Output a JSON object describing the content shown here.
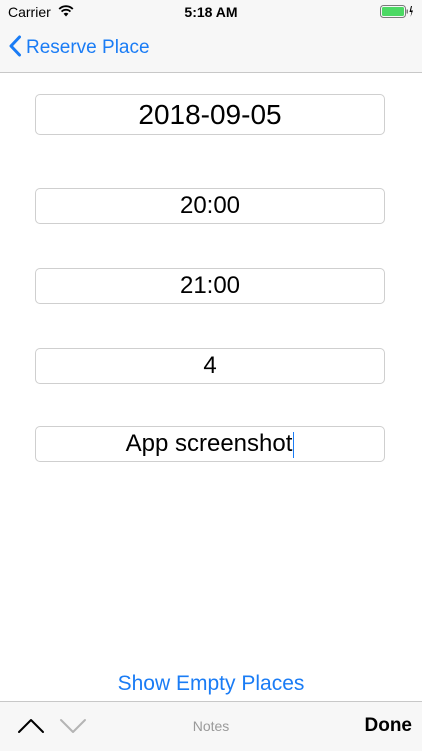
{
  "status_bar": {
    "carrier": "Carrier",
    "time": "5:18 AM",
    "battery_color": "#4cd964"
  },
  "nav": {
    "back_label": "Reserve Place",
    "accent_color": "#1a7cf5"
  },
  "form": {
    "date_value": "2018-09-05",
    "start_time_value": "20:00",
    "end_time_value": "21:00",
    "count_value": "4",
    "notes_value": "App screenshot"
  },
  "actions": {
    "show_empty_label": "Show Empty Places"
  },
  "keyboard_toolbar": {
    "title": "Notes",
    "done_label": "Done",
    "previous_icon": "chevron-up-icon",
    "next_icon": "chevron-down-icon"
  }
}
